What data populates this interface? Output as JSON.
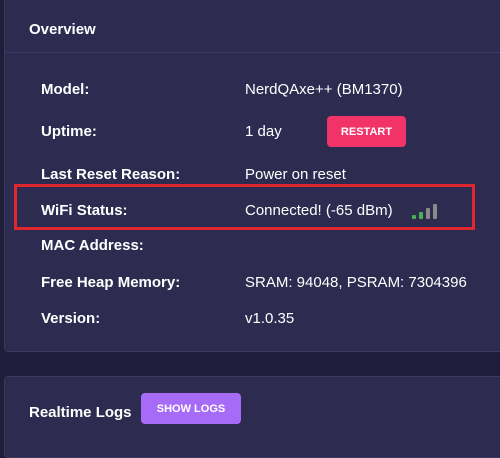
{
  "overview": {
    "title": "Overview",
    "rows": [
      {
        "label": "Model:",
        "value": "NerdQAxe++ (BM1370)"
      },
      {
        "label": "Uptime:",
        "value": "1 day"
      },
      {
        "label": "Last Reset Reason:",
        "value": "Power on reset"
      },
      {
        "label": "WiFi Status:",
        "value": "Connected!  (-65 dBm)"
      },
      {
        "label": "MAC Address:",
        "value": ""
      },
      {
        "label": "Free Heap Memory:",
        "value": "SRAM: 94048, PSRAM: 7304396"
      },
      {
        "label": "Version:",
        "value": "v1.0.35"
      }
    ],
    "restart_label": "RESTART",
    "wifi_signal": {
      "bars_total": 4,
      "bars_active": 2,
      "active_color": "#4caf50",
      "inactive_color": "#8a8a8a"
    }
  },
  "logs": {
    "title": "Realtime Logs",
    "show_logs_label": "SHOW LOGS"
  },
  "colors": {
    "background": "#1f1d3a",
    "card": "#2d2b50",
    "restart_button": "#f13368",
    "show_logs_button": "#a76cf7",
    "highlight_box": "#e0262f"
  }
}
